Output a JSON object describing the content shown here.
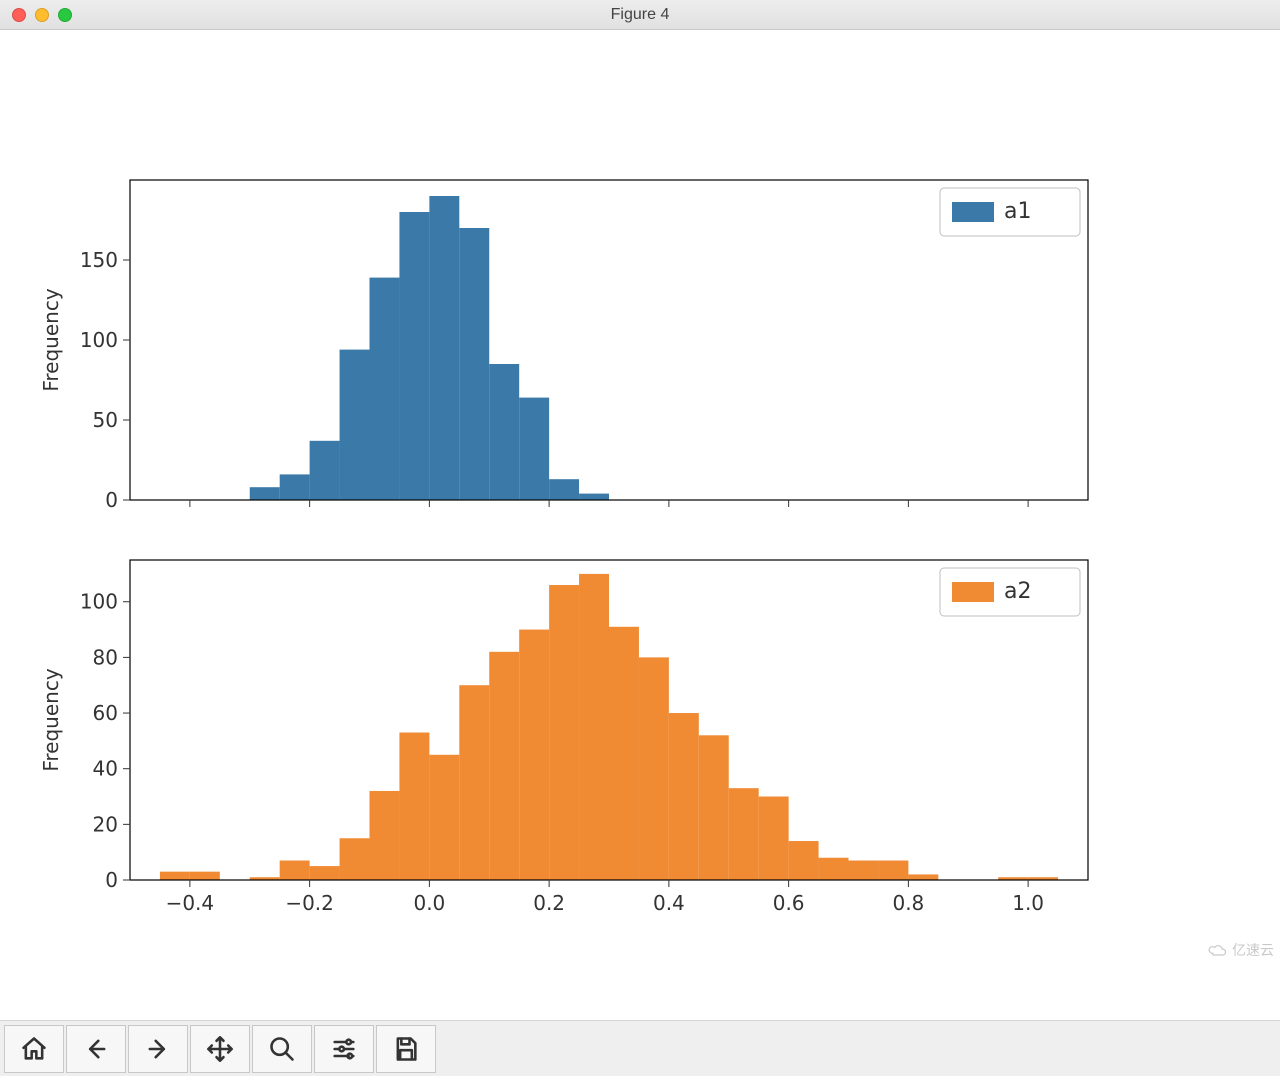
{
  "window": {
    "title": "Figure 4"
  },
  "toolbar": {
    "buttons": [
      "home",
      "back",
      "forward",
      "pan",
      "zoom",
      "configure",
      "save"
    ]
  },
  "watermark": {
    "text": "亿速云"
  },
  "chart_data": [
    {
      "type": "bar",
      "subtype": "histogram",
      "legend": "a1",
      "color": "#3b79a8",
      "ylabel": "Frequency",
      "xlim": [
        -0.5,
        1.1
      ],
      "ylim": [
        0,
        200
      ],
      "yticks": [
        0,
        50,
        100,
        150
      ],
      "bin_width": 0.05,
      "bins_left_edges": [
        -0.3,
        -0.25,
        -0.2,
        -0.15,
        -0.1,
        -0.05,
        0.0,
        0.05,
        0.1,
        0.15,
        0.2,
        0.25
      ],
      "values": [
        8,
        16,
        37,
        94,
        139,
        180,
        190,
        170,
        85,
        64,
        13,
        4
      ]
    },
    {
      "type": "bar",
      "subtype": "histogram",
      "legend": "a2",
      "color": "#f08a33",
      "ylabel": "Frequency",
      "xlim": [
        -0.5,
        1.1
      ],
      "ylim": [
        0,
        115
      ],
      "yticks": [
        0,
        20,
        40,
        60,
        80,
        100
      ],
      "xticks": [
        -0.4,
        -0.2,
        0.0,
        0.2,
        0.4,
        0.6,
        0.8,
        1.0
      ],
      "xtick_labels": [
        "−0.4",
        "−0.2",
        "0.0",
        "0.2",
        "0.4",
        "0.6",
        "0.8",
        "1.0"
      ],
      "bin_width": 0.05,
      "bins_left_edges": [
        -0.45,
        -0.4,
        -0.35,
        -0.3,
        -0.25,
        -0.2,
        -0.15,
        -0.1,
        -0.05,
        0.0,
        0.05,
        0.1,
        0.15,
        0.2,
        0.25,
        0.3,
        0.35,
        0.4,
        0.45,
        0.5,
        0.55,
        0.6,
        0.65,
        0.7,
        0.75,
        0.8,
        0.95,
        1.0
      ],
      "values": [
        3,
        3,
        0,
        1,
        7,
        5,
        15,
        32,
        53,
        45,
        70,
        82,
        90,
        106,
        110,
        91,
        80,
        60,
        52,
        33,
        30,
        14,
        8,
        7,
        7,
        2,
        1,
        1
      ]
    }
  ]
}
